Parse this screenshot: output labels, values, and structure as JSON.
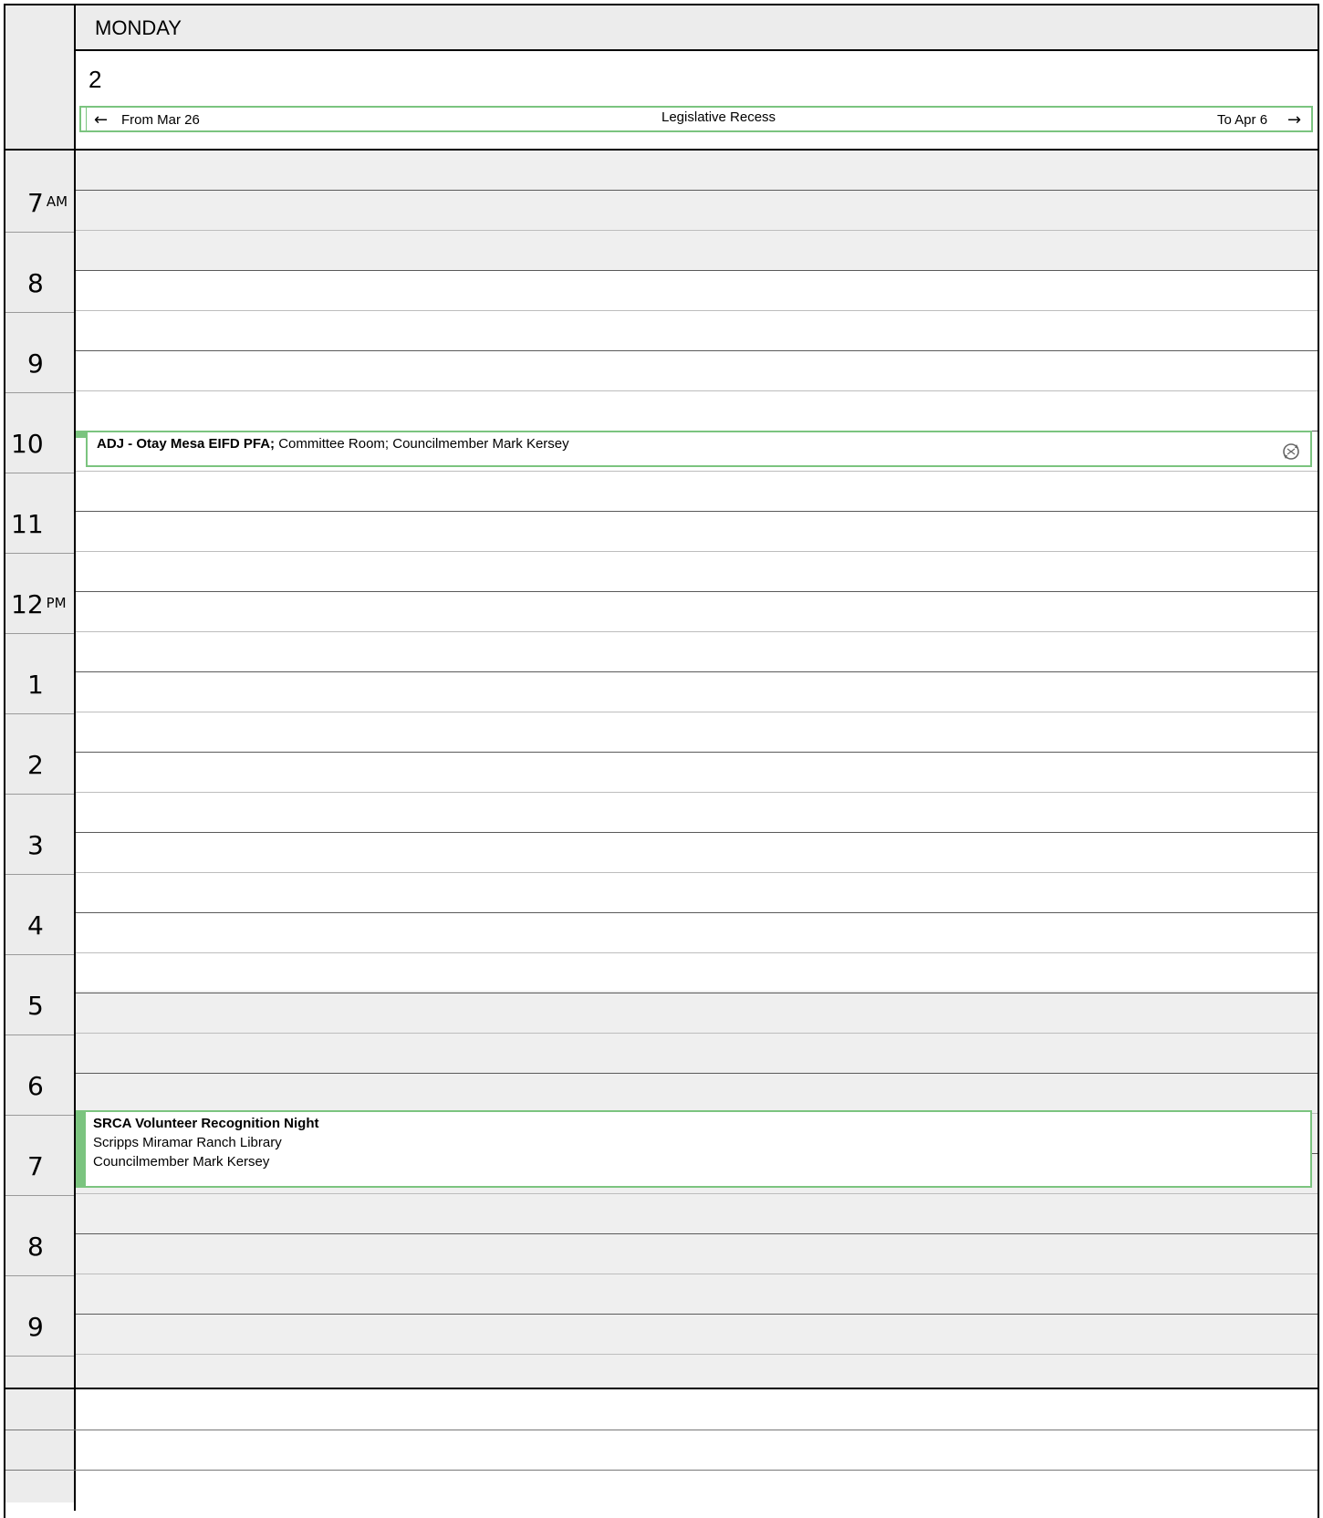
{
  "day_header": {
    "weekday": "MONDAY",
    "date": "2"
  },
  "all_day": {
    "title": "Legislative Recess",
    "from_label": "From Mar 26",
    "to_label": "To Apr 6",
    "left_icon": "arrow-left-icon",
    "right_icon": "arrow-right-icon",
    "accent": "#7bc47f"
  },
  "hours": [
    {
      "label": "7",
      "suffix": "AM"
    },
    {
      "label": "8",
      "suffix": ""
    },
    {
      "label": "9",
      "suffix": ""
    },
    {
      "label": "10",
      "suffix": ""
    },
    {
      "label": "11",
      "suffix": ""
    },
    {
      "label": "12",
      "suffix": "PM"
    },
    {
      "label": "1",
      "suffix": ""
    },
    {
      "label": "2",
      "suffix": ""
    },
    {
      "label": "3",
      "suffix": ""
    },
    {
      "label": "4",
      "suffix": ""
    },
    {
      "label": "5",
      "suffix": ""
    },
    {
      "label": "6",
      "suffix": ""
    },
    {
      "label": "7",
      "suffix": ""
    },
    {
      "label": "8",
      "suffix": ""
    },
    {
      "label": "9",
      "suffix": ""
    }
  ],
  "events": [
    {
      "title": "ADJ - Otay Mesa EIFD PFA;",
      "details": " Committee Room; Councilmember Mark Kersey",
      "icon": "recurring-sync-icon"
    },
    {
      "title": "SRCA Volunteer Recognition Night",
      "location": "Scripps Miramar Ranch Library",
      "organizer": "Councilmember Mark Kersey"
    }
  ],
  "colors": {
    "offhours_bg": "#efefef",
    "gutter_bg": "#ececec",
    "event_border": "#7bc47f",
    "event_bar": "#7bc47f"
  }
}
